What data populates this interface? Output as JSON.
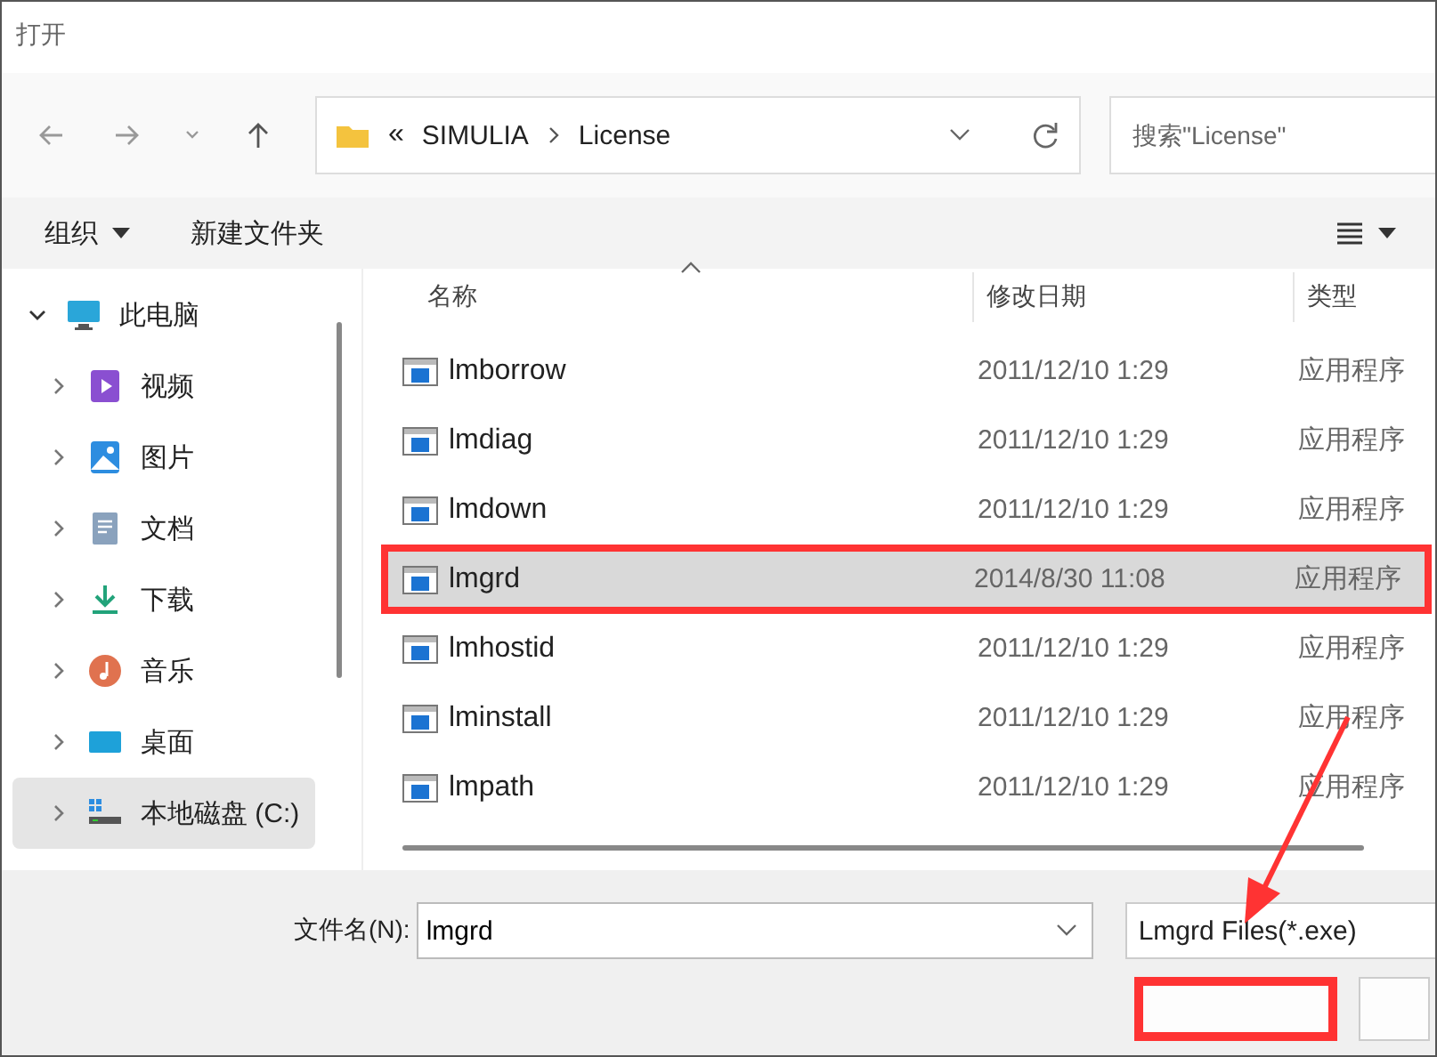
{
  "window": {
    "title": "打开"
  },
  "nav": {
    "path": [
      "«",
      "SIMULIA",
      "License"
    ],
    "search": {
      "placeholder": "搜索\"License\""
    }
  },
  "toolbar": {
    "organize": "组织",
    "new_folder": "新建文件夹"
  },
  "sidebar": {
    "items": [
      {
        "label": "此电脑",
        "kind": "pc",
        "expanded": true,
        "selected": false,
        "children": [
          {
            "label": "视频",
            "kind": "video",
            "expanded": false,
            "selected": false
          },
          {
            "label": "图片",
            "kind": "pictures",
            "expanded": false,
            "selected": false
          },
          {
            "label": "文档",
            "kind": "documents",
            "expanded": false,
            "selected": false
          },
          {
            "label": "下载",
            "kind": "downloads",
            "expanded": false,
            "selected": false
          },
          {
            "label": "音乐",
            "kind": "music",
            "expanded": false,
            "selected": false
          },
          {
            "label": "桌面",
            "kind": "desktop",
            "expanded": false,
            "selected": false
          },
          {
            "label": "本地磁盘 (C:)",
            "kind": "drive",
            "expanded": false,
            "selected": true
          }
        ]
      }
    ]
  },
  "table": {
    "columns": [
      "名称",
      "修改日期",
      "类型"
    ],
    "rows": [
      {
        "name": "lmborrow",
        "date": "2011/12/10 1:29",
        "type": "应用程序",
        "selected": false,
        "highlighted": false
      },
      {
        "name": "lmdiag",
        "date": "2011/12/10 1:29",
        "type": "应用程序",
        "selected": false,
        "highlighted": false
      },
      {
        "name": "lmdown",
        "date": "2011/12/10 1:29",
        "type": "应用程序",
        "selected": false,
        "highlighted": false
      },
      {
        "name": "lmgrd",
        "date": "2014/8/30 11:08",
        "type": "应用程序",
        "selected": true,
        "highlighted": true
      },
      {
        "name": "lmhostid",
        "date": "2011/12/10 1:29",
        "type": "应用程序",
        "selected": false,
        "highlighted": false
      },
      {
        "name": "lminstall",
        "date": "2011/12/10 1:29",
        "type": "应用程序",
        "selected": false,
        "highlighted": false
      },
      {
        "name": "lmpath",
        "date": "2011/12/10 1:29",
        "type": "应用程序",
        "selected": false,
        "highlighted": false
      }
    ]
  },
  "footer": {
    "file_name_label": "文件名(N):",
    "file_name": "lmgrd",
    "filter": "Lmgrd Files(*.exe)",
    "open_button": {
      "highlighted": true
    }
  },
  "annotations": {
    "arrow": true
  }
}
